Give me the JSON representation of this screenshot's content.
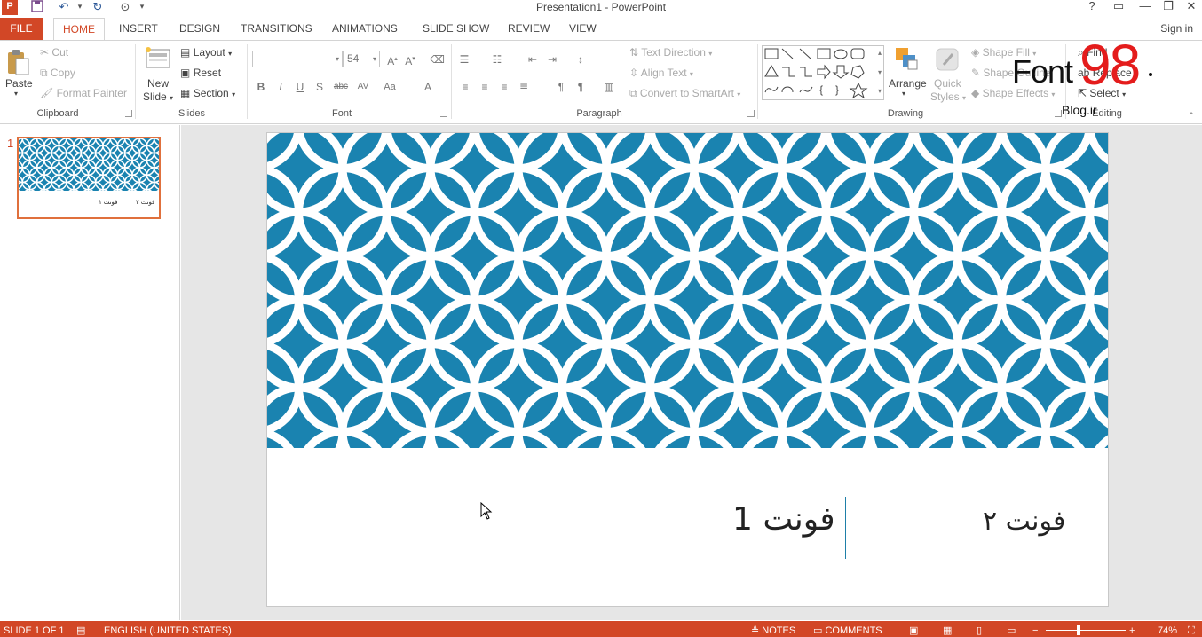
{
  "window": {
    "title": "Presentation1 - PowerPoint",
    "controls": {
      "help": "?",
      "ribbon_options": "▭",
      "minimize": "—",
      "restore": "❐",
      "close": "✕"
    }
  },
  "quick_access": {
    "app_icon": "P",
    "save_icon": "save-icon",
    "undo_icon": "undo-icon",
    "redo_icon": "repeat-icon",
    "present_icon": "slideshow-icon"
  },
  "tabs": [
    {
      "label": "FILE"
    },
    {
      "label": "HOME"
    },
    {
      "label": "INSERT"
    },
    {
      "label": "DESIGN"
    },
    {
      "label": "TRANSITIONS"
    },
    {
      "label": "ANIMATIONS"
    },
    {
      "label": "SLIDE SHOW"
    },
    {
      "label": "REVIEW"
    },
    {
      "label": "VIEW"
    }
  ],
  "sign_in": "Sign in",
  "ribbon": {
    "clipboard": {
      "label": "Clipboard",
      "paste": "Paste",
      "cut": "Cut",
      "copy": "Copy",
      "format_painter": "Format Painter"
    },
    "slides": {
      "label": "Slides",
      "new_slide_1": "New",
      "new_slide_2": "Slide",
      "layout": "Layout",
      "reset": "Reset",
      "section": "Section"
    },
    "font": {
      "label": "Font",
      "font_name": "",
      "font_size": "54",
      "bold": "B",
      "italic": "I",
      "underline": "U",
      "shadow": "S",
      "strike": "abc",
      "spacing": "AV",
      "case": "Aa",
      "color": "A"
    },
    "paragraph": {
      "label": "Paragraph",
      "text_direction": "Text Direction",
      "align_text": "Align Text",
      "smartart": "Convert to SmartArt"
    },
    "drawing": {
      "label": "Drawing",
      "arrange": "Arrange",
      "quick_styles_1": "Quick",
      "quick_styles_2": "Styles",
      "shape_fill": "Shape Fill",
      "shape_outline": "Shape Outline",
      "shape_effects": "Shape Effects"
    },
    "editing": {
      "label": "Editing",
      "find": "Find",
      "replace": "Replace",
      "select": "Select"
    }
  },
  "thumbnail": {
    "number": "1",
    "text_1": "فونت ۱",
    "text_2": "فونت ۲"
  },
  "slide": {
    "pattern_color": "#1a83b0",
    "text_1": "فونت 1",
    "text_2": "فونت ۲"
  },
  "watermark": {
    "word": "Font",
    "number": "98",
    "domain": "Blog.ir"
  },
  "status": {
    "slide_of": "SLIDE 1 OF 1",
    "language": "ENGLISH (UNITED STATES)",
    "notes": "NOTES",
    "comments": "COMMENTS",
    "zoom": "74%"
  }
}
